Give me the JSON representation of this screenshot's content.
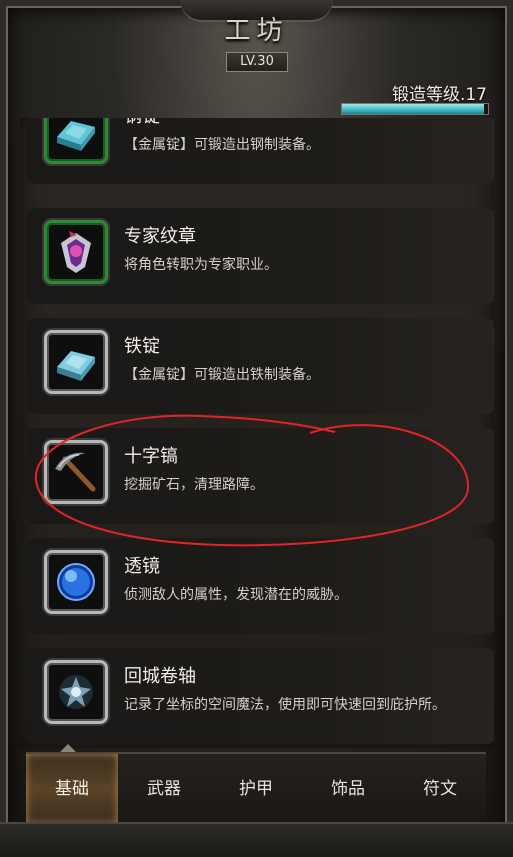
{
  "header": {
    "title": "工坊",
    "level_badge": "LV.30",
    "forge_level_label": "锻造等级.17",
    "forge_progress": 0.97
  },
  "items": [
    {
      "name": "钢锭",
      "desc": "【金属锭】可锻造出钢制装备。",
      "icon": "steel-ingot-icon"
    },
    {
      "name": "专家纹章",
      "desc": "将角色转职为专家职业。",
      "icon": "expert-emblem-icon"
    },
    {
      "name": "铁锭",
      "desc": "【金属锭】可锻造出铁制装备。",
      "icon": "iron-ingot-icon"
    },
    {
      "name": "十字镐",
      "desc": "挖掘矿石，清理路障。",
      "icon": "pickaxe-icon"
    },
    {
      "name": "透镜",
      "desc": "侦测敌人的属性，发现潜在的威胁。",
      "icon": "lens-icon"
    },
    {
      "name": "回城卷轴",
      "desc": "记录了坐标的空间魔法，使用即可快速回到庇护所。",
      "icon": "return-scroll-icon"
    }
  ],
  "tabs": [
    {
      "label": "基础",
      "active": true
    },
    {
      "label": "武器",
      "active": false
    },
    {
      "label": "护甲",
      "active": false
    },
    {
      "label": "饰品",
      "active": false
    },
    {
      "label": "符文",
      "active": false
    }
  ],
  "colors": {
    "progress": "#3fb7c4",
    "annotation": "#e0242c",
    "active_tab": "#5a4327"
  }
}
